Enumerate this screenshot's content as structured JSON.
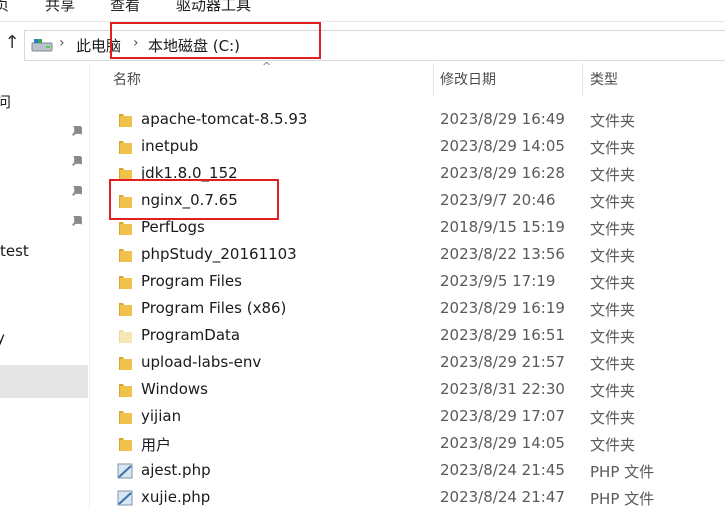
{
  "ribbon": {
    "tabs": [
      "页",
      "共享",
      "查看",
      "驱动器工具"
    ]
  },
  "address_bar": {
    "up_icon": "up-arrow-icon",
    "drive_icon": "drive-icon",
    "crumbs": [
      "此电脑",
      "本地磁盘 (C:)"
    ]
  },
  "nav": {
    "items": [
      "问",
      "test",
      "y"
    ]
  },
  "columns": {
    "name": "名称",
    "modified": "修改日期",
    "type": "类型"
  },
  "files": [
    {
      "name": "apache-tomcat-8.5.93",
      "date": "2023/8/29 16:49",
      "type": "文件夹",
      "kind": "folder"
    },
    {
      "name": "inetpub",
      "date": "2023/8/29 14:05",
      "type": "文件夹",
      "kind": "folder"
    },
    {
      "name": "jdk1.8.0_152",
      "date": "2023/8/29 16:28",
      "type": "文件夹",
      "kind": "folder"
    },
    {
      "name": "nginx_0.7.65",
      "date": "2023/9/7 20:46",
      "type": "文件夹",
      "kind": "folder"
    },
    {
      "name": "PerfLogs",
      "date": "2018/9/15 15:19",
      "type": "文件夹",
      "kind": "folder"
    },
    {
      "name": "phpStudy_20161103",
      "date": "2023/8/22 13:56",
      "type": "文件夹",
      "kind": "folder"
    },
    {
      "name": "Program Files",
      "date": "2023/9/5 17:19",
      "type": "文件夹",
      "kind": "folder"
    },
    {
      "name": "Program Files (x86)",
      "date": "2023/8/29 16:19",
      "type": "文件夹",
      "kind": "folder"
    },
    {
      "name": "ProgramData",
      "date": "2023/8/29 16:51",
      "type": "文件夹",
      "kind": "folder-hidden"
    },
    {
      "name": "upload-labs-env",
      "date": "2023/8/29 21:57",
      "type": "文件夹",
      "kind": "folder"
    },
    {
      "name": "Windows",
      "date": "2023/8/31 22:30",
      "type": "文件夹",
      "kind": "folder"
    },
    {
      "name": "yijian",
      "date": "2023/8/29 17:07",
      "type": "文件夹",
      "kind": "folder"
    },
    {
      "name": "用户",
      "date": "2023/8/29 14:05",
      "type": "文件夹",
      "kind": "folder"
    },
    {
      "name": "ajest.php",
      "date": "2023/8/24 21:45",
      "type": "PHP 文件",
      "kind": "php"
    },
    {
      "name": "xujie.php",
      "date": "2023/8/24 21:47",
      "type": "PHP 文件",
      "kind": "php"
    }
  ],
  "colors": {
    "folder": "#f0c24b",
    "folder_dark": "#dca630",
    "annotation": "#e02020",
    "selection": "#e5e5e5"
  }
}
